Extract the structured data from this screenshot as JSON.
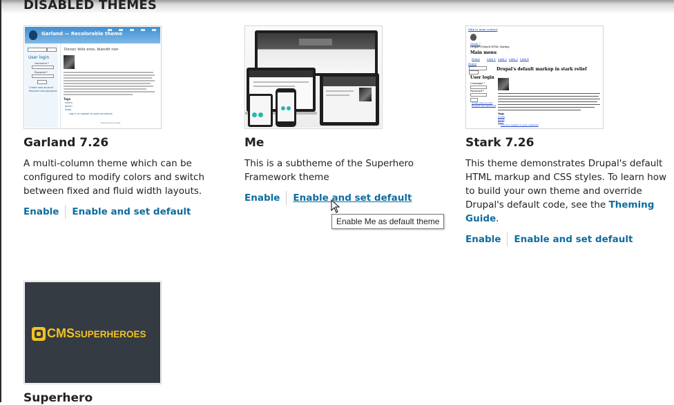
{
  "section_title": "DISABLED THEMES",
  "themes": [
    {
      "name": "Garland 7.26",
      "description": "A multi-column theme which can be configured to modify colors and switch between fixed and fluid width layouts.",
      "enable_label": "Enable",
      "enable_default_label": "Enable and set default",
      "preview": {
        "site_title": "Garland — Recolorable theme",
        "heading": "Donec felis eros, blandit non",
        "login_heading": "User login",
        "username_label": "Username *",
        "password_label": "Password *",
        "login_button": "Log in",
        "create_account": "Create new account",
        "request_password": "Request new password",
        "tags_label": "Tags",
        "tags": [
          "Lorem",
          "Ipsum",
          "Dolor"
        ],
        "login_to_post": "Log in or register to post comments",
        "footer": "Powered by Drupal"
      }
    },
    {
      "name": "Me",
      "description": "This is a subtheme of the Superhero Framework theme",
      "enable_label": "Enable",
      "enable_default_label": "Enable and set default",
      "tooltip": "Enable Me as default theme"
    },
    {
      "name": "Stark 7.26",
      "description_part1": "This theme demonstrates Drupal's default HTML markup and CSS styles. To learn how to build your own theme and override Drupal's default code, see the ",
      "description_link": "Theming Guide",
      "description_part2": ".",
      "enable_label": "Enable",
      "enable_default_label": "Enable and set default",
      "preview": {
        "skip_link": "Skip to main content",
        "site_name": "Stark 7",
        "slogan": "Drupal's Default HTML Markup",
        "main_menu": "Main menu",
        "menu_links": [
          "Home",
          "Link 1",
          "Link 2",
          "Link 3",
          "Link 4"
        ],
        "home_link": "Home",
        "search_button": "Search",
        "login_heading": "User login",
        "username_label": "Username *",
        "password_label": "Password *",
        "login_button": "Log in",
        "create_account": "Create new account",
        "request_password": "Request new password",
        "heading": "Drupal's default markup in stark relief",
        "tags_label": "Tags",
        "tags": [
          "Lorem",
          "Ipsum",
          "Dolor"
        ],
        "login_to_post": "Log in or register to post comments"
      }
    },
    {
      "name": "Superhero",
      "logo_text_big": "CMS",
      "logo_text_small": "SUPERHEROES"
    }
  ],
  "colors": {
    "link": "#0d6c9f",
    "superhero_bg": "#353b43",
    "superhero_gold": "#f2c322"
  }
}
